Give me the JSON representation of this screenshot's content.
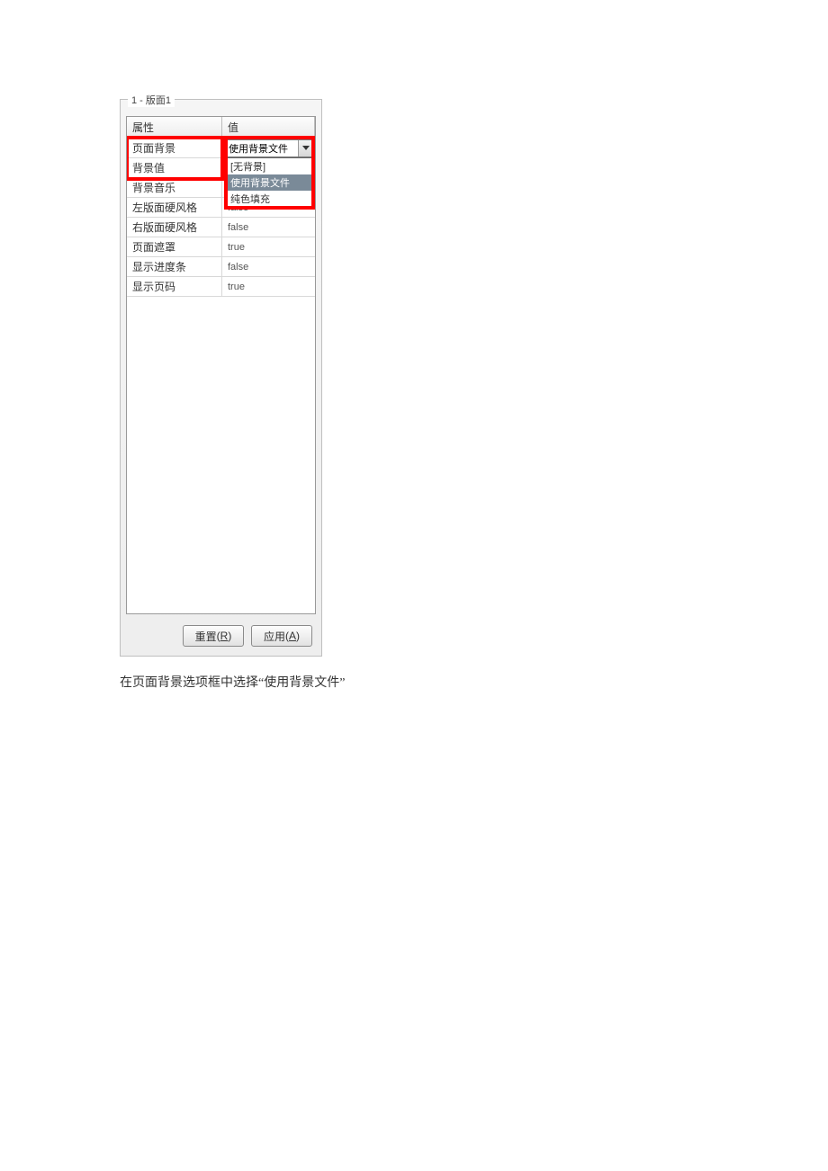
{
  "panel": {
    "title": "1 - 版面1"
  },
  "grid": {
    "header": {
      "prop": "属性",
      "val": "值"
    },
    "rows": [
      {
        "prop": "页面背景",
        "val": "使用背景文件",
        "combo": true
      },
      {
        "prop": "背景值",
        "val": ""
      },
      {
        "prop": "背景音乐",
        "val": ""
      },
      {
        "prop": "左版面硬风格",
        "val": "false"
      },
      {
        "prop": "右版面硬风格",
        "val": "false"
      },
      {
        "prop": "页面遮罩",
        "val": "true"
      },
      {
        "prop": "显示进度条",
        "val": "false"
      },
      {
        "prop": "显示页码",
        "val": "true"
      }
    ]
  },
  "dropdown": {
    "options": [
      {
        "label": "[无背景]",
        "selected": false
      },
      {
        "label": "使用背景文件",
        "selected": true
      },
      {
        "label": "纯色填充",
        "selected": false
      }
    ]
  },
  "buttons": {
    "reset": {
      "text": "重置",
      "accel": "R"
    },
    "apply": {
      "text": "应用",
      "accel": "A"
    }
  },
  "caption": "在页面背景选项框中选择“使用背景文件”"
}
